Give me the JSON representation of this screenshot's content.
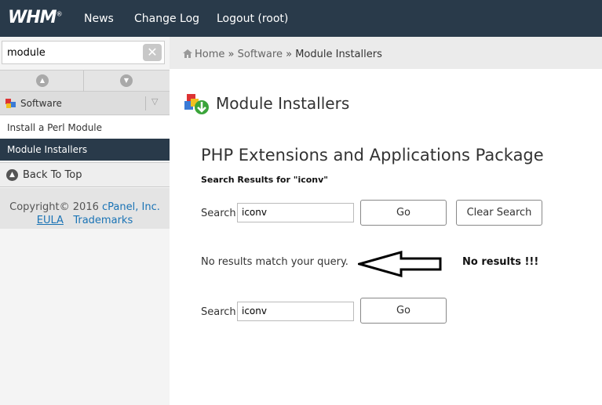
{
  "topbar": {
    "logo": "WHM",
    "logo_mark": "®",
    "nav": [
      "News",
      "Change Log",
      "Logout (root)"
    ]
  },
  "sidebar": {
    "search_value": "module",
    "category": "Software",
    "items": [
      "Install a Perl Module",
      "Module Installers"
    ],
    "back_to_top": "Back To Top",
    "copyright_prefix": "Copyright© 2016",
    "copyright_link": "cPanel, Inc.",
    "eula": "EULA",
    "trademarks": "Trademarks"
  },
  "breadcrumb": {
    "home": "Home",
    "sep": "»",
    "software": "Software",
    "current": "Module Installers"
  },
  "main": {
    "title": "Module Installers",
    "heading": "PHP Extensions and Applications Package",
    "subheading": "Search Results for \"iconv\"",
    "search_label": "Search",
    "search_value": "iconv",
    "go_label": "Go",
    "clear_label": "Clear Search",
    "no_results": "No results match your query.",
    "annotation": "No results !!!"
  }
}
